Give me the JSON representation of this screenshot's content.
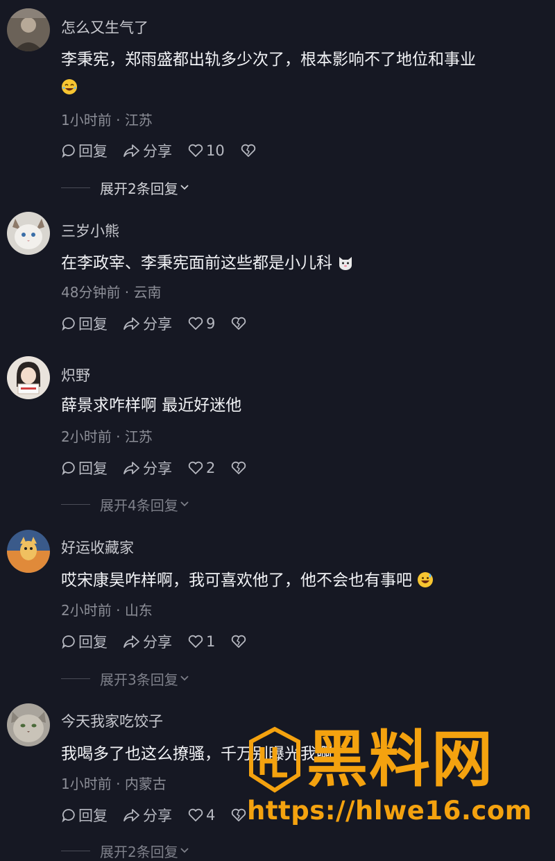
{
  "comments": [
    {
      "username": "怎么又生气了",
      "text": "李秉宪，郑雨盛都出轨多少次了，根本影响不了地位和事业",
      "emoji": "laughing-crying-emoji",
      "time": "1小时前",
      "location": "江苏",
      "reply_label": "回复",
      "share_label": "分享",
      "likes": "10",
      "expand_label": "展开2条回复"
    },
    {
      "username": "三岁小熊",
      "text": "在李政宰、李秉宪面前这些都是小儿科",
      "emoji": "cat-face-emoji",
      "time": "48分钟前",
      "location": "云南",
      "reply_label": "回复",
      "share_label": "分享",
      "likes": "9"
    },
    {
      "username": "炽野",
      "text": "薛景求咋样啊 最近好迷他",
      "time": "2小时前",
      "location": "江苏",
      "reply_label": "回复",
      "share_label": "分享",
      "likes": "2",
      "expand_label": "展开4条回复"
    },
    {
      "username": "好运收藏家",
      "text": "哎宋康昊咋样啊，我可喜欢他了，他不会也有事吧",
      "emoji": "grinning-sweat-emoji",
      "time": "2小时前",
      "location": "山东",
      "reply_label": "回复",
      "share_label": "分享",
      "likes": "1",
      "expand_label": "展开3条回复"
    },
    {
      "username": "今天我家吃饺子",
      "text": "我喝多了也这么撩骚，千万别曝光我啊",
      "time": "1小时前",
      "location": "内蒙古",
      "reply_label": "回复",
      "share_label": "分享",
      "likes": "4",
      "expand_label": "展开2条回复"
    }
  ],
  "separator": " · ",
  "watermark": {
    "title": "黑料网",
    "url": "https://hlwe16.com"
  },
  "colors": {
    "background": "#161823",
    "watermark": "#f4a20f"
  }
}
